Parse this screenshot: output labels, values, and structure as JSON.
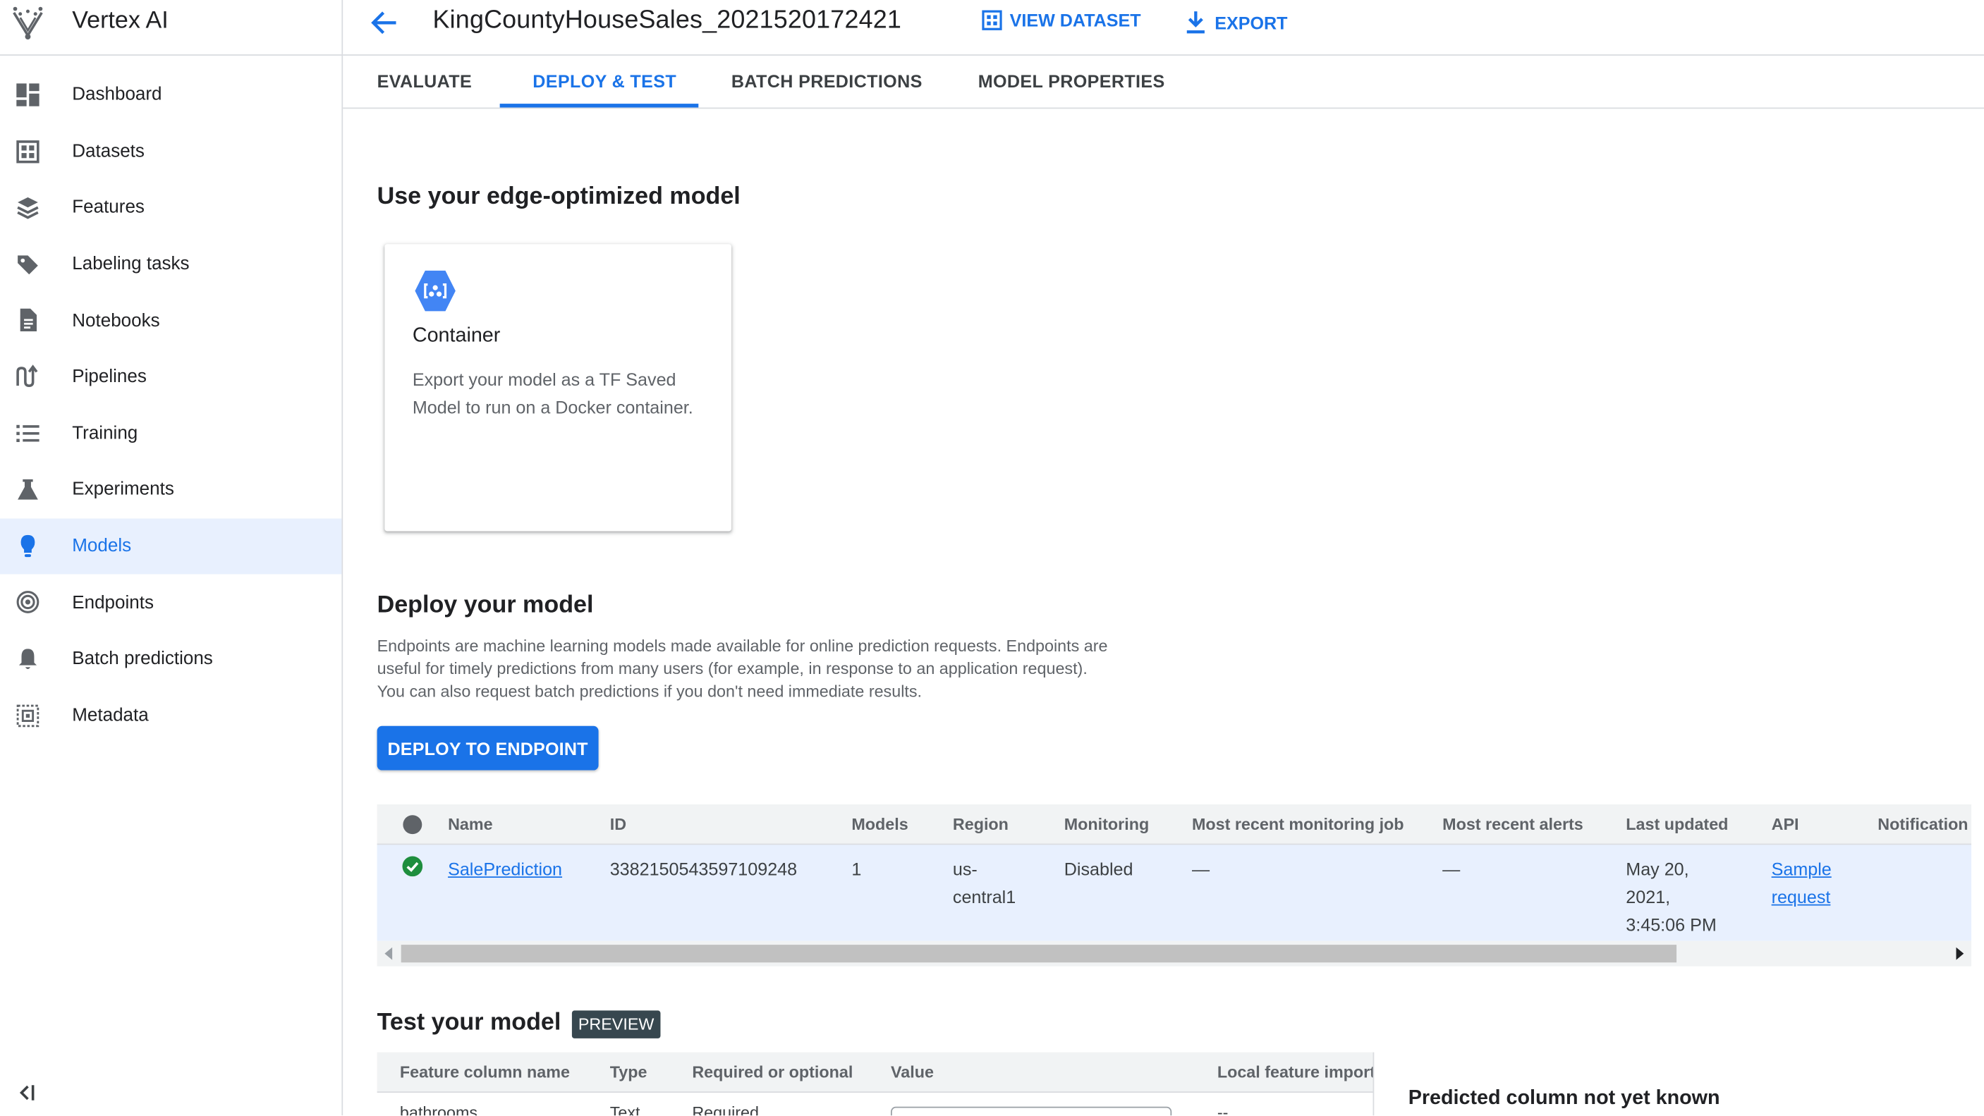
{
  "app": {
    "name": "Vertex AI"
  },
  "sidebar": {
    "items": [
      {
        "label": "Dashboard",
        "icon": "dashboard-icon"
      },
      {
        "label": "Datasets",
        "icon": "datasets-icon"
      },
      {
        "label": "Features",
        "icon": "features-icon"
      },
      {
        "label": "Labeling tasks",
        "icon": "label-tag-icon"
      },
      {
        "label": "Notebooks",
        "icon": "notebook-icon"
      },
      {
        "label": "Pipelines",
        "icon": "pipelines-icon"
      },
      {
        "label": "Training",
        "icon": "training-list-icon"
      },
      {
        "label": "Experiments",
        "icon": "flask-icon"
      },
      {
        "label": "Models",
        "icon": "lightbulb-icon",
        "active": true
      },
      {
        "label": "Endpoints",
        "icon": "endpoints-icon"
      },
      {
        "label": "Batch predictions",
        "icon": "bell-icon"
      },
      {
        "label": "Metadata",
        "icon": "metadata-icon"
      }
    ]
  },
  "header": {
    "title": "KingCountyHouseSales_2021520172421",
    "view_dataset_label": "VIEW DATASET",
    "export_label": "EXPORT"
  },
  "tabs": [
    {
      "label": "EVALUATE"
    },
    {
      "label": "DEPLOY & TEST",
      "active": true
    },
    {
      "label": "BATCH PREDICTIONS"
    },
    {
      "label": "MODEL PROPERTIES"
    }
  ],
  "edge": {
    "heading": "Use your edge-optimized model",
    "card_title": "Container",
    "card_desc": "Export your model as a TF Saved Model to run on a Docker container."
  },
  "deploy": {
    "heading": "Deploy your model",
    "description": "Endpoints are machine learning models made available for online prediction requests. Endpoints are useful for timely predictions from many users (for example, in response to an application request). You can also request batch predictions if you don't need immediate results.",
    "button_label": "DEPLOY TO ENDPOINT"
  },
  "endpoints_table": {
    "columns": [
      "Name",
      "ID",
      "Models",
      "Region",
      "Monitoring",
      "Most recent monitoring job",
      "Most recent alerts",
      "Last updated",
      "API",
      "Notification"
    ],
    "row": {
      "name": "SalePrediction",
      "id": "3382150543597109248",
      "models": "1",
      "region": "us-central1",
      "monitoring": "Disabled",
      "recent_job": "—",
      "recent_alerts": "—",
      "last_updated": "May 20, 2021, 3:45:06 PM",
      "api": "Sample request"
    }
  },
  "test": {
    "heading": "Test your model",
    "badge": "PREVIEW",
    "columns": [
      "Feature column name",
      "Type",
      "Required or optional",
      "Value",
      "Local feature importa"
    ],
    "first_row": {
      "name": "bathrooms",
      "type": "Text",
      "required": "Required",
      "importance": "--"
    },
    "predicted_heading": "Predicted column not yet known"
  },
  "colors": {
    "accent": "#1a73e8",
    "active_bg": "#e8f0fe",
    "success": "#1e8e3e"
  }
}
